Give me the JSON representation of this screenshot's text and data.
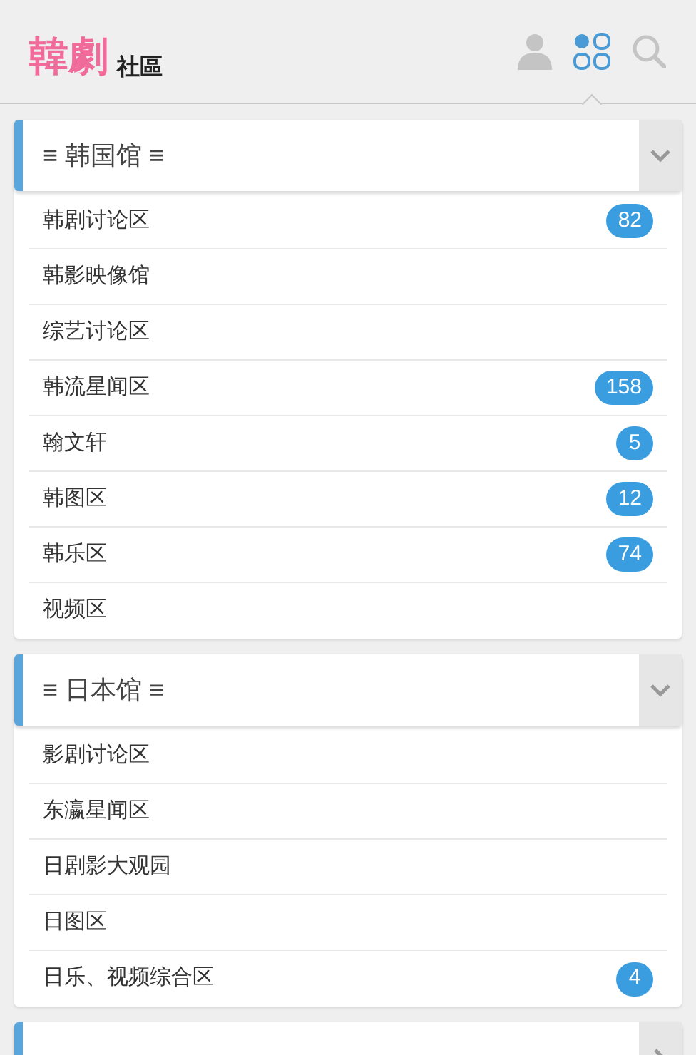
{
  "logo": {
    "mark": "韓劇",
    "text": "社區"
  },
  "nav": [
    {
      "kind": "user",
      "selected": false
    },
    {
      "kind": "grid",
      "selected": true
    },
    {
      "kind": "search",
      "selected": false
    }
  ],
  "sections": [
    {
      "title": "≡ 韩国馆 ≡",
      "expanded": true,
      "items": [
        {
          "label": "韩剧讨论区",
          "badge": "82"
        },
        {
          "label": "韩影映像馆"
        },
        {
          "label": "综艺讨论区"
        },
        {
          "label": "韩流星闻区",
          "badge": "158"
        },
        {
          "label": "翰文轩",
          "badge": "5"
        },
        {
          "label": "韩图区",
          "badge": "12"
        },
        {
          "label": "韩乐区",
          "badge": "74"
        },
        {
          "label": "视频区"
        }
      ]
    },
    {
      "title": "≡ 日本馆 ≡",
      "expanded": true,
      "items": [
        {
          "label": "影剧讨论区"
        },
        {
          "label": "东瀛星闻区"
        },
        {
          "label": "日剧影大观园"
        },
        {
          "label": "日图区"
        },
        {
          "label": "日乐、视频综合区",
          "badge": "4"
        }
      ]
    },
    {
      "expanded": false
    }
  ]
}
